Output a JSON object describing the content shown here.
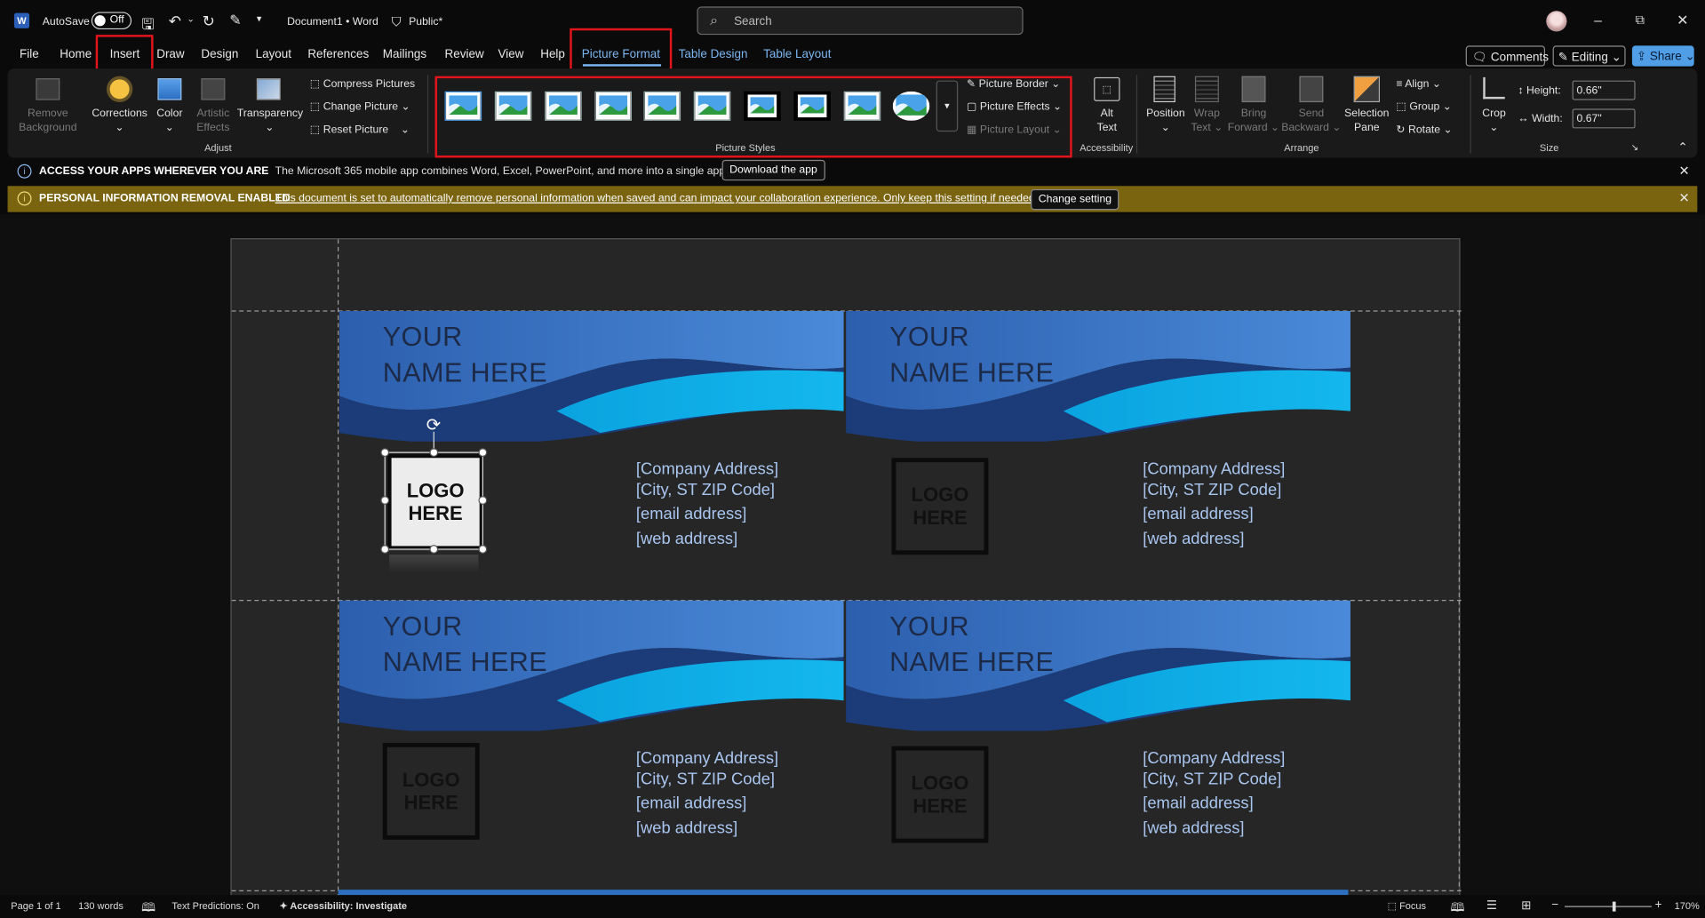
{
  "title_bar": {
    "autosave_label": "AutoSave",
    "autosave_state": "Off",
    "doc_title": "Document1 • Word",
    "sensitivity": "Public*",
    "search_placeholder": "Search"
  },
  "menu_tabs": [
    "File",
    "Home",
    "Insert",
    "Draw",
    "Design",
    "Layout",
    "References",
    "Mailings",
    "Review",
    "View",
    "Help",
    "Picture Format",
    "Table Design",
    "Table Layout"
  ],
  "active_tab": "Picture Format",
  "header_buttons": {
    "comments": "Comments",
    "editing": "Editing",
    "share": "Share"
  },
  "ribbon": {
    "adjust": {
      "remove_background": [
        "Remove",
        "Background"
      ],
      "corrections": "Corrections",
      "color": "Color",
      "artistic_effects": [
        "Artistic",
        "Effects"
      ],
      "transparency": "Transparency",
      "compress": "Compress Pictures",
      "change": "Change Picture",
      "reset": "Reset Picture",
      "group_label": "Adjust"
    },
    "styles": {
      "picture_border": "Picture Border",
      "picture_effects": "Picture Effects",
      "picture_layout": "Picture Layout",
      "group_label": "Picture Styles"
    },
    "accessibility": {
      "alt_text": [
        "Alt",
        "Text"
      ],
      "group_label": "Accessibility"
    },
    "arrange": {
      "position": "Position",
      "wrap_text": [
        "Wrap",
        "Text"
      ],
      "bring_forward": [
        "Bring",
        "Forward"
      ],
      "send_backward": [
        "Send",
        "Backward"
      ],
      "selection_pane": [
        "Selection",
        "Pane"
      ],
      "align": "Align",
      "group": "Group",
      "rotate": "Rotate",
      "group_label": "Arrange"
    },
    "size": {
      "crop": "Crop",
      "height_label": "Height:",
      "height_value": "0.66\"",
      "width_label": "Width:",
      "width_value": "0.67\"",
      "group_label": "Size"
    }
  },
  "info_bars": {
    "apps": {
      "title": "ACCESS YOUR APPS WHEREVER YOU ARE",
      "message": "The Microsoft 365 mobile app combines Word, Excel, PowerPoint, and more into a single app.",
      "button": "Download the app"
    },
    "privacy": {
      "title": "PERSONAL INFORMATION REMOVAL ENABLED",
      "message": "This document is set to automatically remove personal information when saved and can impact your collaboration experience. Only keep this setting if needed.",
      "button": "Change setting"
    }
  },
  "cards": [
    {
      "name1": "YOUR",
      "name2": "NAME HERE",
      "logo1": "LOGO",
      "logo2": "HERE",
      "addr": "[Company Address]",
      "city": "[City, ST  ZIP Code]",
      "email": "[email address]",
      "web": "[web address]"
    },
    {
      "name1": "YOUR",
      "name2": "NAME HERE",
      "logo1": "LOGO",
      "logo2": "HERE",
      "addr": "[Company Address]",
      "city": "[City, ST  ZIP Code]",
      "email": "[email address]",
      "web": "[web address]"
    },
    {
      "name1": "YOUR",
      "name2": "NAME HERE",
      "logo1": "LOGO",
      "logo2": "HERE",
      "addr": "[Company Address]",
      "city": "[City, ST  ZIP Code]",
      "email": "[email address]",
      "web": "[web address]"
    },
    {
      "name1": "YOUR",
      "name2": "NAME HERE",
      "logo1": "LOGO",
      "logo2": "HERE",
      "addr": "[Company Address]",
      "city": "[City, ST  ZIP Code]",
      "email": "[email address]",
      "web": "[web address]"
    }
  ],
  "status_bar": {
    "page": "Page 1 of 1",
    "words": "130 words",
    "text_predictions": "Text Predictions: On",
    "accessibility": "Accessibility: Investigate",
    "focus": "Focus",
    "zoom": "170%"
  },
  "colors": {
    "accent": "#4f9ee6",
    "highlight_box": "#e4141b",
    "privacy_bar": "#7a6410",
    "wave_light": "#3f7fd0",
    "wave_dark": "#1c3d75",
    "wave_cyan": "#00a8e0"
  }
}
